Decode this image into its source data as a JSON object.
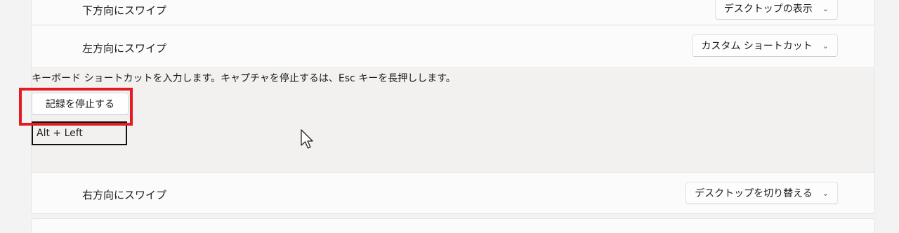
{
  "rows": {
    "down": {
      "label": "下方向にスワイプ",
      "dropdown": "デスクトップの表示"
    },
    "left": {
      "label": "左方向にスワイプ",
      "dropdown": "カスタム ショートカット"
    },
    "right": {
      "label": "右方向にスワイプ",
      "dropdown": "デスクトップを切り替える"
    }
  },
  "recorder": {
    "instruction": "キーボード ショートカットを入力します。キャプチャを停止するは、Esc キーを長押しします。",
    "stop_button": "記録を停止する",
    "shortcut_value": "Alt + Left"
  },
  "icons": {
    "chevron": "chevron-down-icon",
    "cursor": "mouse-pointer-icon"
  },
  "colors": {
    "highlight": "#e21c22",
    "background": "#f3f3f3",
    "card": "#fbfbfb"
  }
}
